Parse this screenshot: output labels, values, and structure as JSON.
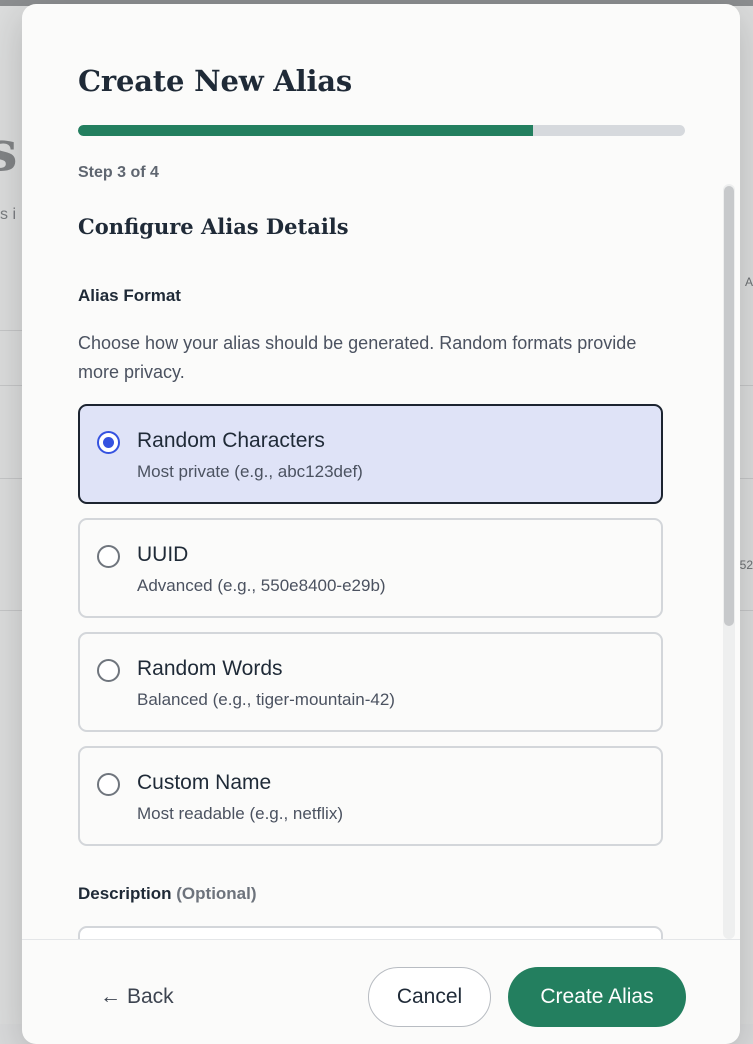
{
  "background": {
    "big_letter": "s",
    "sub_fragment": "s i",
    "right_fragments": [
      "A",
      "52"
    ]
  },
  "modal": {
    "title": "Create New Alias",
    "progress": 0.75,
    "step_label": "Step 3 of 4",
    "section_title": "Configure Alias Details",
    "alias_format": {
      "label": "Alias Format",
      "help": "Choose how your alias should be generated. Random formats provide more privacy.",
      "options": [
        {
          "title": "Random Characters",
          "subtitle": "Most private (e.g., abc123def)",
          "selected": true
        },
        {
          "title": "UUID",
          "subtitle": "Advanced (e.g., 550e8400-e29b)",
          "selected": false
        },
        {
          "title": "Random Words",
          "subtitle": "Balanced (e.g., tiger-mountain-42)",
          "selected": false
        },
        {
          "title": "Custom Name",
          "subtitle": "Most readable (e.g., netflix)",
          "selected": false
        }
      ]
    },
    "description": {
      "label": "Description",
      "optional": "(Optional)",
      "value": ""
    },
    "footer": {
      "back_icon": "←",
      "back_label": "Back",
      "cancel_label": "Cancel",
      "create_label": "Create Alias"
    },
    "colors": {
      "accent_green": "#237f5f",
      "selected_bg": "#dfe3f7",
      "radio_blue": "#3552e0"
    }
  }
}
